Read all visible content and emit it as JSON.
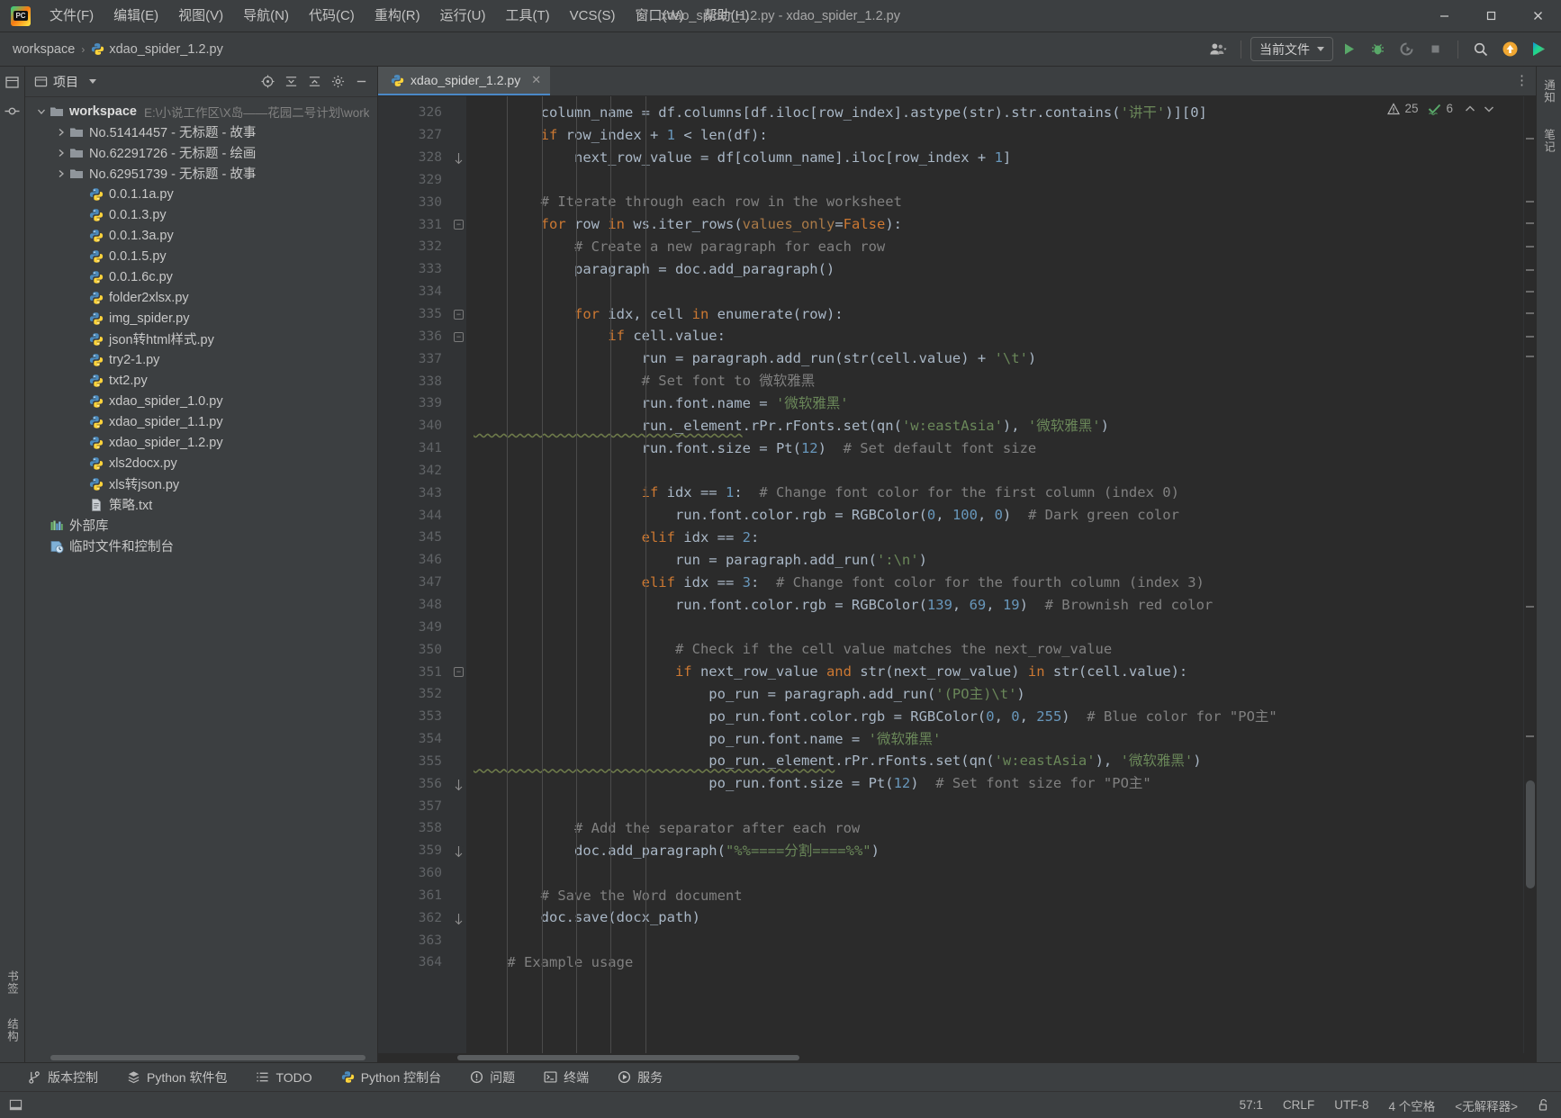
{
  "window": {
    "title": "xdao_spider_1.2.py - xdao_spider_1.2.py",
    "minimize_label": "—",
    "maximize_label": "▢",
    "close_label": "✕",
    "logo_text": "PC"
  },
  "menu": {
    "items": [
      {
        "label": "文件(F)",
        "name": "menu-file"
      },
      {
        "label": "编辑(E)",
        "name": "menu-edit"
      },
      {
        "label": "视图(V)",
        "name": "menu-view"
      },
      {
        "label": "导航(N)",
        "name": "menu-navigate"
      },
      {
        "label": "代码(C)",
        "name": "menu-code"
      },
      {
        "label": "重构(R)",
        "name": "menu-refactor"
      },
      {
        "label": "运行(U)",
        "name": "menu-run"
      },
      {
        "label": "工具(T)",
        "name": "menu-tools"
      },
      {
        "label": "VCS(S)",
        "name": "menu-vcs"
      },
      {
        "label": "窗口(W)",
        "name": "menu-window"
      },
      {
        "label": "帮助(H)",
        "name": "menu-help"
      }
    ]
  },
  "navbar": {
    "breadcrumb_root": "workspace",
    "breadcrumb_file": "xdao_spider_1.2.py",
    "separator": "›",
    "run_config": "当前文件",
    "icons": {
      "account": "account-icon",
      "run": "run-icon",
      "debug": "debug-icon",
      "coverage": "run-coverage-icon",
      "stop": "stop-icon",
      "search": "search-everywhere-icon",
      "update": "update-project-icon",
      "ide_assistant": "ai-assistant-icon"
    }
  },
  "project_panel": {
    "title": "项目",
    "tools": [
      "select-opened-file-icon",
      "collapse-all-icon",
      "expand-all-icon",
      "settings-icon",
      "hide-icon"
    ],
    "tree": [
      {
        "label": "workspace",
        "path": "E:\\小说工作区\\X岛——花园二号计划\\work",
        "type": "root",
        "depth": 0,
        "expanded": true,
        "icon": "folder-icon"
      },
      {
        "label": "No.51414457 - 无标题 - 故事",
        "type": "folder",
        "depth": 1,
        "expanded": false,
        "icon": "folder-icon"
      },
      {
        "label": "No.62291726 - 无标题 - 绘画",
        "type": "folder",
        "depth": 1,
        "expanded": false,
        "icon": "folder-icon"
      },
      {
        "label": "No.62951739 - 无标题 - 故事",
        "type": "folder",
        "depth": 1,
        "expanded": false,
        "icon": "folder-icon"
      },
      {
        "label": "0.0.1.1a.py",
        "type": "python",
        "depth": 2,
        "icon": "python-file-icon"
      },
      {
        "label": "0.0.1.3.py",
        "type": "python",
        "depth": 2,
        "icon": "python-file-icon"
      },
      {
        "label": "0.0.1.3a.py",
        "type": "python",
        "depth": 2,
        "icon": "python-file-icon"
      },
      {
        "label": "0.0.1.5.py",
        "type": "python",
        "depth": 2,
        "icon": "python-file-icon"
      },
      {
        "label": "0.0.1.6c.py",
        "type": "python",
        "depth": 2,
        "icon": "python-file-icon"
      },
      {
        "label": "folder2xlsx.py",
        "type": "python",
        "depth": 2,
        "icon": "python-file-icon"
      },
      {
        "label": "img_spider.py",
        "type": "python",
        "depth": 2,
        "icon": "python-file-icon"
      },
      {
        "label": "json转html样式.py",
        "type": "python",
        "depth": 2,
        "icon": "python-file-icon"
      },
      {
        "label": "try2-1.py",
        "type": "python",
        "depth": 2,
        "icon": "python-file-icon"
      },
      {
        "label": "txt2.py",
        "type": "python",
        "depth": 2,
        "icon": "python-file-icon"
      },
      {
        "label": "xdao_spider_1.0.py",
        "type": "python",
        "depth": 2,
        "icon": "python-file-icon"
      },
      {
        "label": "xdao_spider_1.1.py",
        "type": "python",
        "depth": 2,
        "icon": "python-file-icon"
      },
      {
        "label": "xdao_spider_1.2.py",
        "type": "python",
        "depth": 2,
        "icon": "python-file-icon"
      },
      {
        "label": "xls2docx.py",
        "type": "python",
        "depth": 2,
        "icon": "python-file-icon"
      },
      {
        "label": "xls转json.py",
        "type": "python",
        "depth": 2,
        "icon": "python-file-icon"
      },
      {
        "label": "策略.txt",
        "type": "text",
        "depth": 2,
        "icon": "text-file-icon"
      },
      {
        "label": "外部库",
        "type": "libs",
        "depth": 0,
        "icon": "external-libraries-icon"
      },
      {
        "label": "临时文件和控制台",
        "type": "scratches",
        "depth": 0,
        "icon": "scratches-icon"
      }
    ]
  },
  "left_strip": {
    "top_items": [
      {
        "label": "项目",
        "name": "tool-project"
      },
      {
        "label": "",
        "name": "commit-icon"
      }
    ],
    "bottom_items": [
      {
        "label": "书签",
        "name": "tool-bookmarks"
      },
      {
        "label": "结构",
        "name": "tool-structure"
      }
    ]
  },
  "right_strip": {
    "items": [
      {
        "label": "通知",
        "name": "tool-notifications"
      },
      {
        "label": "笔记",
        "name": "tool-notes"
      }
    ]
  },
  "editor": {
    "tab_label": "xdao_spider_1.2.py",
    "tab_close": "✕",
    "inspection": {
      "warnings": "25",
      "weak_warnings": "6",
      "warn_icon": "warning-triangle-icon",
      "ok_icon": "inspection-ok-icon",
      "chev": "⌃"
    },
    "first_line_number": 326,
    "lines": [
      {
        "n": 326,
        "tokens": [
          {
            "t": "        column_name = df.columns[df.iloc[row_index].astype(str).str.contains(",
            "c": "plain"
          },
          {
            "t": "'讲干'",
            "c": "str"
          },
          {
            "t": ")][0]",
            "c": "plain"
          }
        ]
      },
      {
        "n": 327,
        "tokens": [
          {
            "t": "        ",
            "c": "plain"
          },
          {
            "t": "if",
            "c": "kw"
          },
          {
            "t": " row_index + ",
            "c": "plain"
          },
          {
            "t": "1",
            "c": "num"
          },
          {
            "t": " < len(df):",
            "c": "plain"
          }
        ]
      },
      {
        "n": 328,
        "fold": "end",
        "tokens": [
          {
            "t": "            next_row_value = df[column_name].iloc[row_index + ",
            "c": "plain"
          },
          {
            "t": "1",
            "c": "num"
          },
          {
            "t": "]",
            "c": "plain"
          }
        ]
      },
      {
        "n": 329,
        "tokens": []
      },
      {
        "n": 330,
        "tokens": [
          {
            "t": "        # Iterate through each row in the worksheet",
            "c": "cmt"
          }
        ]
      },
      {
        "n": 331,
        "fold": "start",
        "tokens": [
          {
            "t": "        ",
            "c": "plain"
          },
          {
            "t": "for",
            "c": "kw"
          },
          {
            "t": " row ",
            "c": "plain"
          },
          {
            "t": "in",
            "c": "kw"
          },
          {
            "t": " ws.iter_rows(",
            "c": "plain"
          },
          {
            "t": "values_only",
            "c": "kwarg"
          },
          {
            "t": "=",
            "c": "plain"
          },
          {
            "t": "False",
            "c": "kw"
          },
          {
            "t": "):",
            "c": "plain"
          }
        ]
      },
      {
        "n": 332,
        "tokens": [
          {
            "t": "            # Create a new paragraph for each row",
            "c": "cmt"
          }
        ]
      },
      {
        "n": 333,
        "tokens": [
          {
            "t": "            paragraph = doc.add_paragraph()",
            "c": "plain"
          }
        ]
      },
      {
        "n": 334,
        "tokens": []
      },
      {
        "n": 335,
        "fold": "start",
        "tokens": [
          {
            "t": "            ",
            "c": "plain"
          },
          {
            "t": "for",
            "c": "kw"
          },
          {
            "t": " idx, cell ",
            "c": "plain"
          },
          {
            "t": "in",
            "c": "kw"
          },
          {
            "t": " enumerate(row):",
            "c": "plain"
          }
        ]
      },
      {
        "n": 336,
        "fold": "start",
        "tokens": [
          {
            "t": "                ",
            "c": "plain"
          },
          {
            "t": "if",
            "c": "kw"
          },
          {
            "t": " cell.value:",
            "c": "plain"
          }
        ]
      },
      {
        "n": 337,
        "tokens": [
          {
            "t": "                    run = paragraph.add_run(str(cell.value) + ",
            "c": "plain"
          },
          {
            "t": "'\\t'",
            "c": "str"
          },
          {
            "t": ")",
            "c": "plain"
          }
        ]
      },
      {
        "n": 338,
        "tokens": [
          {
            "t": "                    # Set font to 微软雅黑",
            "c": "cmt"
          }
        ]
      },
      {
        "n": 339,
        "tokens": [
          {
            "t": "                    run.font.name = ",
            "c": "plain"
          },
          {
            "t": "'微软雅黑'",
            "c": "str"
          }
        ]
      },
      {
        "n": 340,
        "wavy": true,
        "tokens": [
          {
            "t": "                    run._element",
            "c": "deco"
          },
          {
            "t": ".rPr.rFonts.set(qn(",
            "c": "plain"
          },
          {
            "t": "'w:eastAsia'",
            "c": "str"
          },
          {
            "t": "), ",
            "c": "plain"
          },
          {
            "t": "'微软雅黑'",
            "c": "str"
          },
          {
            "t": ")",
            "c": "plain"
          }
        ]
      },
      {
        "n": 341,
        "tokens": [
          {
            "t": "                    run.font.size = Pt(",
            "c": "plain"
          },
          {
            "t": "12",
            "c": "num"
          },
          {
            "t": ")  ",
            "c": "plain"
          },
          {
            "t": "# Set default font size",
            "c": "cmt"
          }
        ]
      },
      {
        "n": 342,
        "tokens": []
      },
      {
        "n": 343,
        "tokens": [
          {
            "t": "                    ",
            "c": "plain"
          },
          {
            "t": "if",
            "c": "kw"
          },
          {
            "t": " idx == ",
            "c": "plain"
          },
          {
            "t": "1",
            "c": "num"
          },
          {
            "t": ":  ",
            "c": "plain"
          },
          {
            "t": "# Change font color for the first column (index 0)",
            "c": "cmt"
          }
        ]
      },
      {
        "n": 344,
        "tokens": [
          {
            "t": "                        run.font.color.rgb = RGBColor(",
            "c": "plain"
          },
          {
            "t": "0",
            "c": "num"
          },
          {
            "t": ", ",
            "c": "plain"
          },
          {
            "t": "100",
            "c": "num"
          },
          {
            "t": ", ",
            "c": "plain"
          },
          {
            "t": "0",
            "c": "num"
          },
          {
            "t": ")  ",
            "c": "plain"
          },
          {
            "t": "# Dark green color",
            "c": "cmt"
          }
        ]
      },
      {
        "n": 345,
        "tokens": [
          {
            "t": "                    ",
            "c": "plain"
          },
          {
            "t": "elif",
            "c": "kw"
          },
          {
            "t": " idx == ",
            "c": "plain"
          },
          {
            "t": "2",
            "c": "num"
          },
          {
            "t": ":",
            "c": "plain"
          }
        ]
      },
      {
        "n": 346,
        "tokens": [
          {
            "t": "                        run = paragraph.add_run(",
            "c": "plain"
          },
          {
            "t": "':\\n'",
            "c": "str"
          },
          {
            "t": ")",
            "c": "plain"
          }
        ]
      },
      {
        "n": 347,
        "tokens": [
          {
            "t": "                    ",
            "c": "plain"
          },
          {
            "t": "elif",
            "c": "kw"
          },
          {
            "t": " idx == ",
            "c": "plain"
          },
          {
            "t": "3",
            "c": "num"
          },
          {
            "t": ":  ",
            "c": "plain"
          },
          {
            "t": "# Change font color for the fourth column (index 3)",
            "c": "cmt"
          }
        ]
      },
      {
        "n": 348,
        "tokens": [
          {
            "t": "                        run.font.color.rgb = RGBColor(",
            "c": "plain"
          },
          {
            "t": "139",
            "c": "num"
          },
          {
            "t": ", ",
            "c": "plain"
          },
          {
            "t": "69",
            "c": "num"
          },
          {
            "t": ", ",
            "c": "plain"
          },
          {
            "t": "19",
            "c": "num"
          },
          {
            "t": ")  ",
            "c": "plain"
          },
          {
            "t": "# Brownish red color",
            "c": "cmt"
          }
        ]
      },
      {
        "n": 349,
        "tokens": []
      },
      {
        "n": 350,
        "tokens": [
          {
            "t": "                        # Check if the cell value matches the next_row_value",
            "c": "cmt"
          }
        ]
      },
      {
        "n": 351,
        "fold": "start",
        "tokens": [
          {
            "t": "                        ",
            "c": "plain"
          },
          {
            "t": "if",
            "c": "kw"
          },
          {
            "t": " next_row_value ",
            "c": "plain"
          },
          {
            "t": "and",
            "c": "kw"
          },
          {
            "t": " str(next_row_value) ",
            "c": "plain"
          },
          {
            "t": "in",
            "c": "kw"
          },
          {
            "t": " str(cell.value):",
            "c": "plain"
          }
        ]
      },
      {
        "n": 352,
        "tokens": [
          {
            "t": "                            po_run = paragraph.add_run(",
            "c": "plain"
          },
          {
            "t": "'(PO主)\\t'",
            "c": "str"
          },
          {
            "t": ")",
            "c": "plain"
          }
        ]
      },
      {
        "n": 353,
        "tokens": [
          {
            "t": "                            po_run.font.color.rgb = RGBColor(",
            "c": "plain"
          },
          {
            "t": "0",
            "c": "num"
          },
          {
            "t": ", ",
            "c": "plain"
          },
          {
            "t": "0",
            "c": "num"
          },
          {
            "t": ", ",
            "c": "plain"
          },
          {
            "t": "255",
            "c": "num"
          },
          {
            "t": ")  ",
            "c": "plain"
          },
          {
            "t": "# Blue color for \"PO主\"",
            "c": "cmt"
          }
        ]
      },
      {
        "n": 354,
        "tokens": [
          {
            "t": "                            po_run.font.name = ",
            "c": "plain"
          },
          {
            "t": "'微软雅黑'",
            "c": "str"
          }
        ]
      },
      {
        "n": 355,
        "wavy": true,
        "tokens": [
          {
            "t": "                            po_run._element",
            "c": "deco"
          },
          {
            "t": ".rPr.rFonts.set(qn(",
            "c": "plain"
          },
          {
            "t": "'w:eastAsia'",
            "c": "str"
          },
          {
            "t": "), ",
            "c": "plain"
          },
          {
            "t": "'微软雅黑'",
            "c": "str"
          },
          {
            "t": ")",
            "c": "plain"
          }
        ]
      },
      {
        "n": 356,
        "fold": "end",
        "tokens": [
          {
            "t": "                            po_run.font.size = Pt(",
            "c": "plain"
          },
          {
            "t": "12",
            "c": "num"
          },
          {
            "t": ")  ",
            "c": "plain"
          },
          {
            "t": "# Set font size for \"PO主\"",
            "c": "cmt"
          }
        ]
      },
      {
        "n": 357,
        "tokens": []
      },
      {
        "n": 358,
        "tokens": [
          {
            "t": "            # Add the separator after each row",
            "c": "cmt"
          }
        ]
      },
      {
        "n": 359,
        "fold": "end",
        "tokens": [
          {
            "t": "            doc.add_paragraph(",
            "c": "plain"
          },
          {
            "t": "\"%%====分割====%%\"",
            "c": "str"
          },
          {
            "t": ")",
            "c": "plain"
          }
        ]
      },
      {
        "n": 360,
        "tokens": []
      },
      {
        "n": 361,
        "tokens": [
          {
            "t": "        # Save the Word document",
            "c": "cmt"
          }
        ]
      },
      {
        "n": 362,
        "fold": "end",
        "tokens": [
          {
            "t": "        doc.save(docx_path)",
            "c": "plain"
          }
        ]
      },
      {
        "n": 363,
        "tokens": []
      },
      {
        "n": 364,
        "tokens": [
          {
            "t": "    # Example usage",
            "c": "cmt"
          }
        ]
      }
    ]
  },
  "tool_windows": [
    {
      "label": "版本控制",
      "icon": "vcs-branch-icon",
      "name": "toolwin-version-control"
    },
    {
      "label": "Python 软件包",
      "icon": "python-packages-icon",
      "name": "toolwin-python-packages"
    },
    {
      "label": "TODO",
      "icon": "todo-icon",
      "name": "toolwin-todo"
    },
    {
      "label": "Python 控制台",
      "icon": "python-console-icon",
      "name": "toolwin-python-console"
    },
    {
      "label": "问题",
      "icon": "problems-icon",
      "name": "toolwin-problems"
    },
    {
      "label": "终端",
      "icon": "terminal-icon",
      "name": "toolwin-terminal"
    },
    {
      "label": "服务",
      "icon": "services-icon",
      "name": "toolwin-services"
    }
  ],
  "statusbar": {
    "caret": "57:1",
    "line_separator": "CRLF",
    "encoding": "UTF-8",
    "indent": "4 个空格",
    "interpreter": "<无解释器>",
    "lock_icon": "unlocked-icon"
  },
  "colors": {
    "bg_chrome": "#3c3f41",
    "bg_editor": "#2b2b2b",
    "bg_gutter": "#313335",
    "accent_tab": "#4a88c7",
    "keyword": "#cc7832",
    "string": "#6a8759",
    "number": "#6897bb",
    "comment": "#808080",
    "text": "#a9b7c6",
    "run_green": "#59a869"
  }
}
